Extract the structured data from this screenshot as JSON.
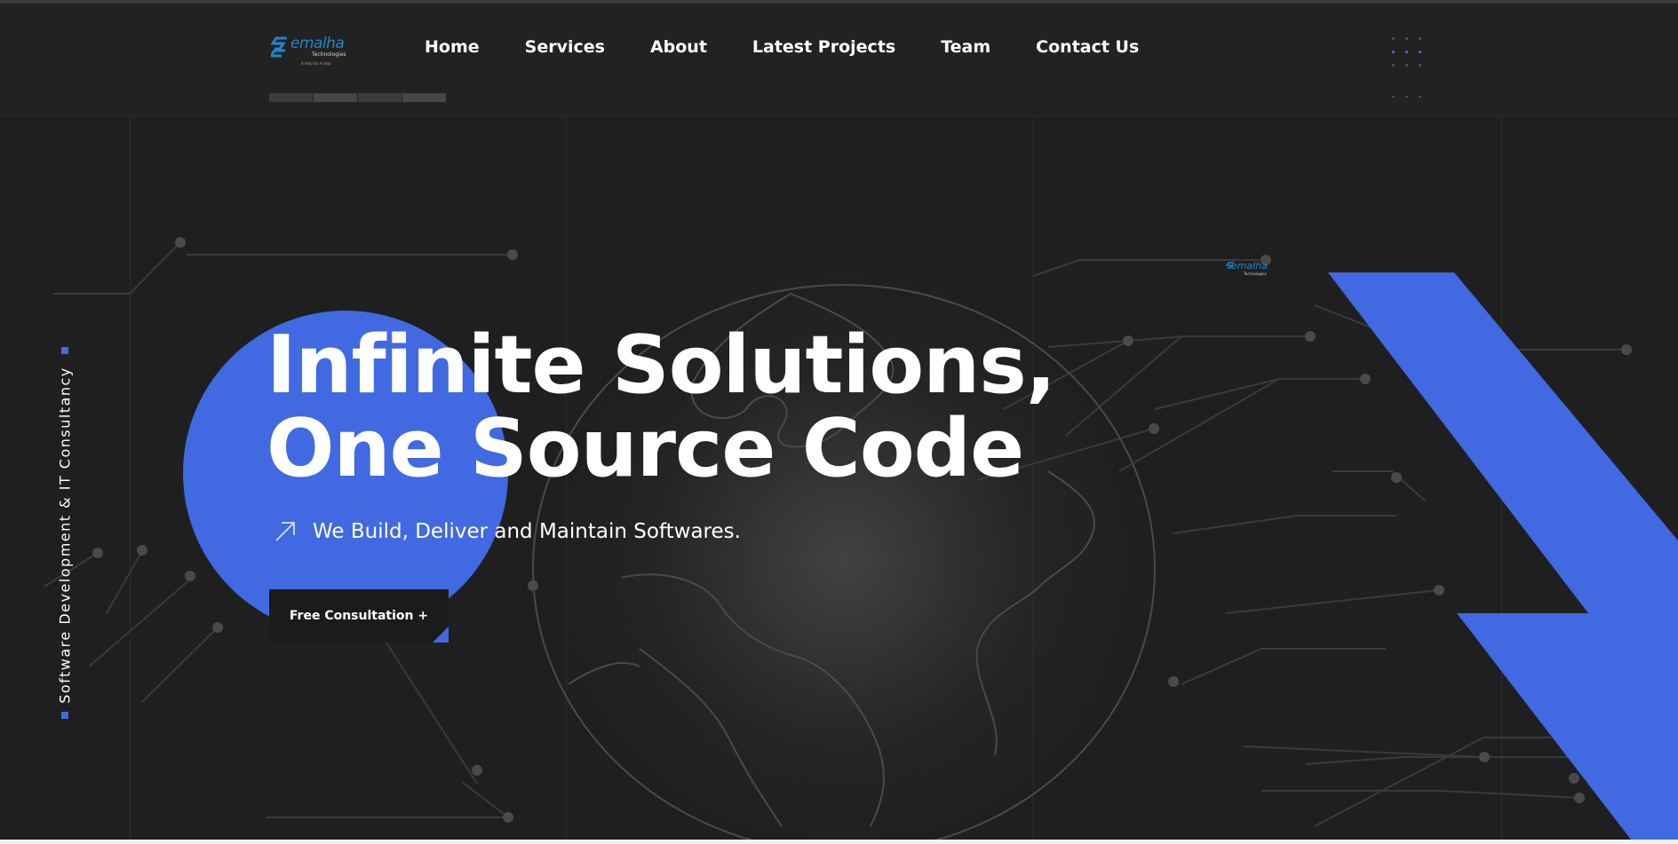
{
  "brand": {
    "logo_word": "emalha",
    "logo_sub": "Technologies",
    "logo_tagline": "A step for A step",
    "mini_logo_word": "emalha",
    "mini_logo_sub": "Technologies"
  },
  "nav": {
    "items": [
      {
        "label": "Home"
      },
      {
        "label": "Services"
      },
      {
        "label": "About"
      },
      {
        "label": "Latest Projects"
      },
      {
        "label": "Team"
      },
      {
        "label": "Contact Us"
      }
    ]
  },
  "hero": {
    "headline_line1": "Infinite Solutions,",
    "headline_line2": "One Source Code",
    "subheadline": "We Build, Deliver and Maintain Softwares.",
    "subheadline_icon": "arrow-up-right-icon",
    "cta_label": "Free Consultation +",
    "side_text": "Software Development & IT Consultancy"
  },
  "colors": {
    "accent": "#4169e1",
    "background": "#1f1f1f",
    "header": "#222222",
    "logo_blue": "#1e88c8"
  }
}
